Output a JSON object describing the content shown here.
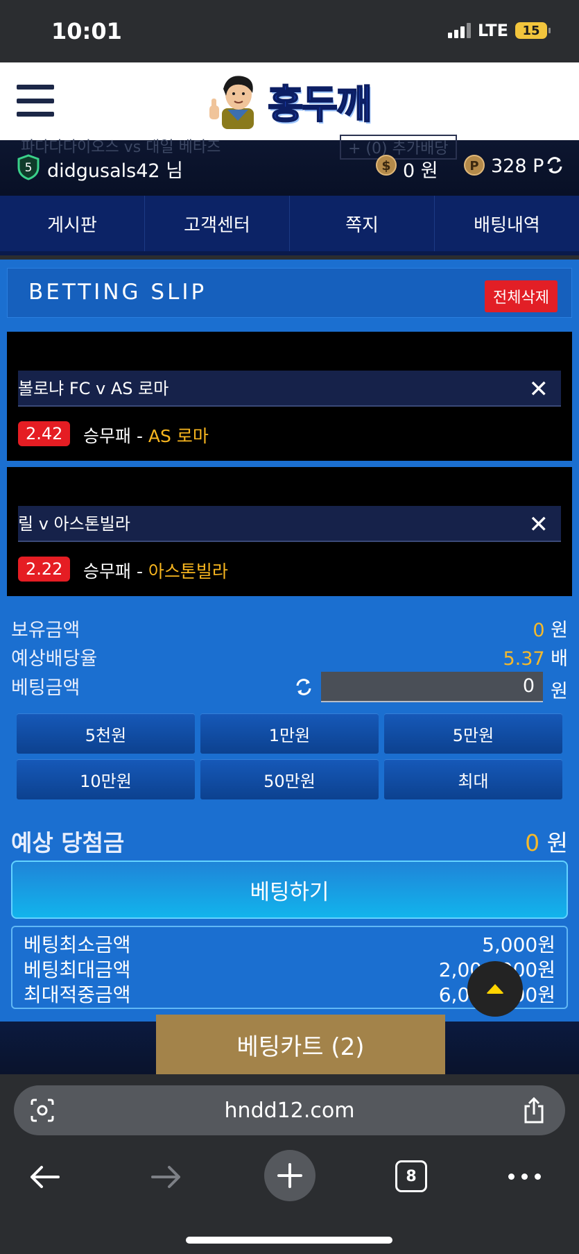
{
  "status_bar": {
    "time": "10:01",
    "network": "LTE",
    "battery": "15"
  },
  "header": {
    "logo_text": "홍두깨",
    "menu_icon": "hamburger-icon"
  },
  "user_bar": {
    "ghost_left": "파다다다이오스 vs 대일 베타즈",
    "ghost_right": "+ (0) 추가배당",
    "level": "5",
    "username": "didgusals42 님",
    "money": "0 원",
    "points": "328 P"
  },
  "nav": {
    "items": [
      "게시판",
      "고객센터",
      "쪽지",
      "배팅내역"
    ]
  },
  "slip": {
    "title": "BETTING SLIP",
    "clear_all": "전체삭제",
    "bets": [
      {
        "match": "볼로냐 FC v AS 로마",
        "odd": "2.42",
        "market": "승무패 -",
        "selection": "AS 로마"
      },
      {
        "match": "릴 v 아스톤빌라",
        "odd": "2.22",
        "market": "승무패 -",
        "selection": "아스톤빌라"
      }
    ],
    "balance_label": "보유금액",
    "balance_value": "0",
    "balance_unit": "원",
    "odds_label": "예상배당율",
    "odds_value": "5.37",
    "odds_unit": "배",
    "stake_label": "베팅금액",
    "stake_value": "0",
    "stake_unit": "원",
    "amount_buttons": [
      "5천원",
      "1만원",
      "5만원",
      "10만원",
      "50만원",
      "최대"
    ],
    "expected_label": "예상 당첨금",
    "expected_value": "0",
    "expected_unit": "원",
    "bet_button": "베팅하기",
    "limits": [
      {
        "label": "베팅최소금액",
        "value": "5,000원"
      },
      {
        "label": "베팅최대금액",
        "value": "2,000,000원"
      },
      {
        "label": "최대적중금액",
        "value": "6,000,000원"
      }
    ]
  },
  "cart_button": "베팅카트 (2)",
  "browser": {
    "url": "hndd12.com",
    "tab_count": "8"
  }
}
